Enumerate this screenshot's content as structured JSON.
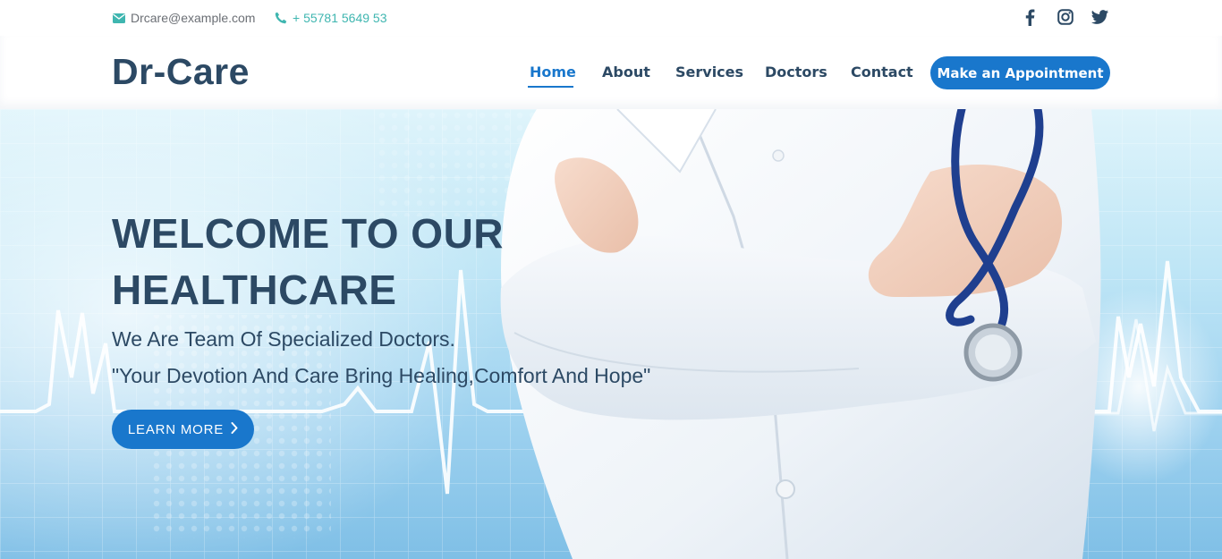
{
  "topbar": {
    "email": "Drcare@example.com",
    "phone": "+ 55781 5649 53",
    "email_icon": "envelope-icon",
    "phone_icon": "phone-icon",
    "social": [
      "facebook-icon",
      "instagram-icon",
      "twitter-icon"
    ]
  },
  "header": {
    "logo": "Dr-Care",
    "nav": {
      "home": "Home",
      "about": "About",
      "services": "Services",
      "doctors": "Doctors",
      "contact": "Contact"
    },
    "appointment_label": "Make an Appointment"
  },
  "hero": {
    "title": "WELCOME TO OUR HEALTHCARE",
    "subtitle": "We Are Team Of Specialized Doctors.",
    "quote": "\"Your Devotion And Care Bring Healing,Comfort And Hope\"",
    "button_label": "LEARN MORE",
    "button_icon": "chevron-right-icon"
  },
  "colors": {
    "brand": "#1977cc",
    "heading": "#2c4964",
    "accent": "#3fb6b0"
  }
}
